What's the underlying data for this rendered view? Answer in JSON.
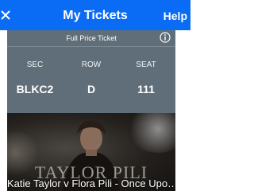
{
  "header": {
    "title": "My Tickets",
    "help_label": "Help",
    "close_icon": "close-icon"
  },
  "ticket": {
    "ticket_type": "Full Price Ticket",
    "info_icon": "info-icon",
    "columns": [
      {
        "label": "SEC",
        "value": "BLKC2"
      },
      {
        "label": "ROW",
        "value": "D"
      },
      {
        "label": "SEAT",
        "value": "111"
      }
    ]
  },
  "event": {
    "title": "Katie Taylor v Flora Pili - Once Upo…",
    "image_text": "TAYLOR PILI"
  },
  "colors": {
    "header": "#0a6cf5",
    "card": "#5f6e78"
  }
}
